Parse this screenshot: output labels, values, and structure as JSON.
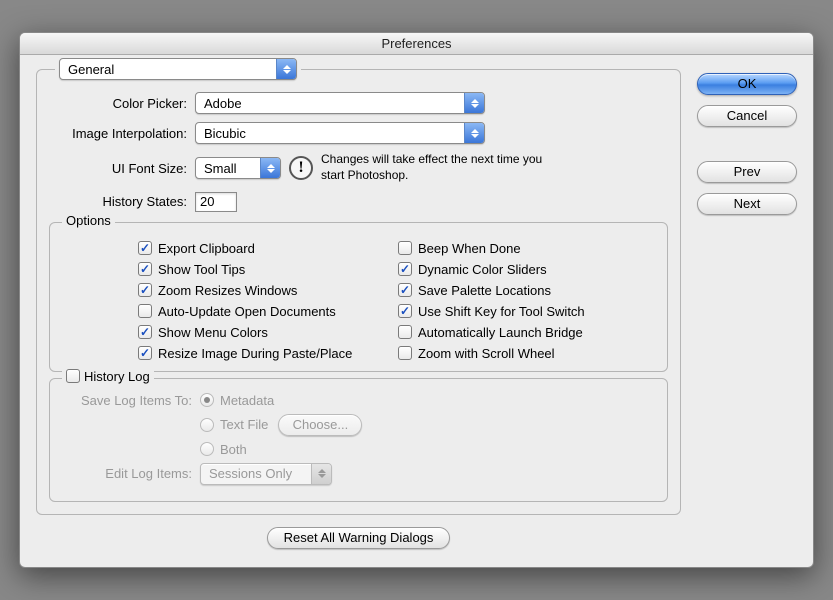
{
  "title": "Preferences",
  "category": "General",
  "labels": {
    "color_picker": "Color Picker:",
    "image_interpolation": "Image Interpolation:",
    "ui_font_size": "UI Font Size:",
    "history_states": "History States:",
    "save_log_items_to": "Save Log Items To:",
    "edit_log_items": "Edit Log Items:"
  },
  "values": {
    "color_picker": "Adobe",
    "image_interpolation": "Bicubic",
    "ui_font_size": "Small",
    "history_states": "20",
    "edit_log_items": "Sessions Only"
  },
  "note": "Changes will take effect the next time you start Photoshop.",
  "options_legend": "Options",
  "options_left": [
    {
      "label": "Export Clipboard",
      "checked": true
    },
    {
      "label": "Show Tool Tips",
      "checked": true
    },
    {
      "label": "Zoom Resizes Windows",
      "checked": true
    },
    {
      "label": "Auto-Update Open Documents",
      "checked": false
    },
    {
      "label": "Show Menu Colors",
      "checked": true
    },
    {
      "label": "Resize Image During Paste/Place",
      "checked": true
    }
  ],
  "options_right": [
    {
      "label": "Beep When Done",
      "checked": false
    },
    {
      "label": "Dynamic Color Sliders",
      "checked": true
    },
    {
      "label": "Save Palette Locations",
      "checked": true
    },
    {
      "label": "Use Shift Key for Tool Switch",
      "checked": true
    },
    {
      "label": "Automatically Launch Bridge",
      "checked": false
    },
    {
      "label": "Zoom with Scroll Wheel",
      "checked": false
    }
  ],
  "history_log": {
    "legend": "History Log",
    "enabled": false,
    "radios": [
      {
        "label": "Metadata",
        "selected": true
      },
      {
        "label": "Text File",
        "selected": false
      },
      {
        "label": "Both",
        "selected": false
      }
    ],
    "choose": "Choose..."
  },
  "reset_button": "Reset All Warning Dialogs",
  "buttons": {
    "ok": "OK",
    "cancel": "Cancel",
    "prev": "Prev",
    "next": "Next"
  }
}
